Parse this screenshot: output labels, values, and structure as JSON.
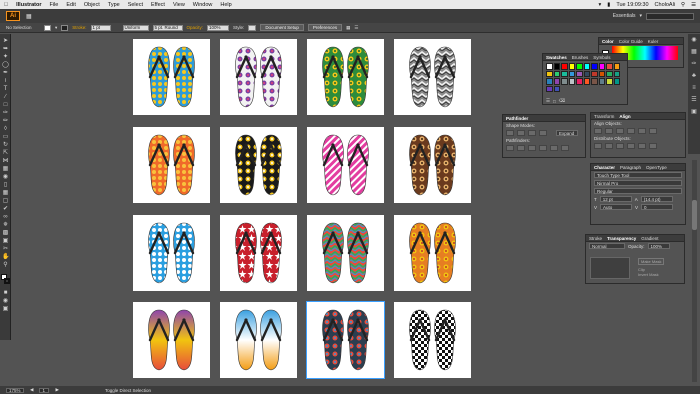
{
  "menubar": {
    "apple": "",
    "app": "Illustrator",
    "items": [
      "File",
      "Edit",
      "Object",
      "Type",
      "Select",
      "Effect",
      "View",
      "Window",
      "Help"
    ],
    "clock": "Tue 19:09:30",
    "user": "CholoAli"
  },
  "appbar": {
    "logo": "Ai",
    "workspace": "Essentials"
  },
  "control": {
    "selection": "No Selection",
    "stroke_label": "Stroke:",
    "stroke_value": "1 pt",
    "profile": "Uniform",
    "brush": "5 pt. Round",
    "opacity_label": "Opacity:",
    "opacity_value": "100%",
    "style_label": "Style:",
    "doc_setup": "Document Setup",
    "preferences": "Preferences"
  },
  "status": {
    "zoom": "175%",
    "page": "1",
    "tool": "Toggle Direct Selection"
  },
  "panels": {
    "color": {
      "tabs": [
        "Color",
        "Color Guide",
        "Kuler"
      ]
    },
    "swatches": {
      "tabs": [
        "Swatches",
        "Brushes",
        "Symbols"
      ]
    },
    "transform": {
      "tabs": [
        "Transform",
        "Align"
      ]
    },
    "pathfinder": {
      "tabs": [
        "Pathfinder"
      ],
      "shape_modes": "Shape Modes:",
      "expand": "Expand",
      "pathfinders": "Pathfinders:",
      "align_objects": "Align Objects:",
      "distribute_objects": "Distribute Objects:"
    },
    "character": {
      "tabs": [
        "Character",
        "Paragraph",
        "OpenType"
      ],
      "search": "Touch Type Tool",
      "font": "Nirmal Pro",
      "style": "Regular",
      "size": "12 pt",
      "leading": "(14.4 pt)",
      "kerning": "Auto",
      "tracking": "0"
    },
    "transparency": {
      "tabs": [
        "Stroke",
        "Transparency",
        "Gradient"
      ],
      "mode": "Normal",
      "opacity_label": "Opacity:",
      "opacity": "100%",
      "make_mask": "Make Mask",
      "clip": "Clip",
      "invert": "Invert Mask"
    }
  },
  "tiles": [
    {
      "id": "1",
      "pattern": "dots",
      "colors": [
        "#2e9bd6",
        "#f7c81e",
        "#2fae58"
      ]
    },
    {
      "id": "2",
      "pattern": "flowers",
      "colors": [
        "#f2f2f2",
        "#7b3fa0",
        "#e2407c"
      ]
    },
    {
      "id": "3",
      "pattern": "leaves",
      "colors": [
        "#2d8c3c",
        "#f5c71a",
        "#1f6a2b"
      ]
    },
    {
      "id": "4",
      "pattern": "zigzag",
      "colors": [
        "#8a8a8a",
        "#f0f0f0",
        "#3a3a3a"
      ]
    },
    {
      "id": "5",
      "pattern": "dots",
      "colors": [
        "#f06a2a",
        "#f9c23c",
        "#e23b2c"
      ]
    },
    {
      "id": "6",
      "pattern": "flowers",
      "colors": [
        "#1a1a1a",
        "#f3c51e",
        "#ffffff"
      ]
    },
    {
      "id": "7",
      "pattern": "stripes",
      "colors": [
        "#e33da0",
        "#ffffff",
        "#b21b7c"
      ]
    },
    {
      "id": "8",
      "pattern": "ethnic",
      "colors": [
        "#6a3a1e",
        "#e5b06a",
        "#3a1f0e"
      ]
    },
    {
      "id": "9",
      "pattern": "dots",
      "colors": [
        "#2c9fe0",
        "#ffffff",
        "#1b6fb8"
      ]
    },
    {
      "id": "10",
      "pattern": "stars",
      "colors": [
        "#c8202c",
        "#ffffff",
        "#1a1a1a"
      ]
    },
    {
      "id": "11",
      "pattern": "chevron",
      "colors": [
        "#e74c3c",
        "#27ae60",
        "#3498db"
      ]
    },
    {
      "id": "12",
      "pattern": "ethnic",
      "colors": [
        "#e67e22",
        "#f1c40f",
        "#c0392b"
      ]
    },
    {
      "id": "13",
      "pattern": "rainbow",
      "colors": [
        "#8e44ad",
        "#f1c40f",
        "#e74c3c"
      ]
    },
    {
      "id": "14",
      "pattern": "rainbow",
      "colors": [
        "#3aa0e0",
        "#ffffff",
        "#f39c12"
      ]
    },
    {
      "id": "15",
      "pattern": "icons",
      "colors": [
        "#2c3e50",
        "#e74c3c",
        "#3498db"
      ],
      "selected": true
    },
    {
      "id": "16",
      "pattern": "checker",
      "colors": [
        "#111111",
        "#ffffff",
        "#555555"
      ]
    }
  ]
}
